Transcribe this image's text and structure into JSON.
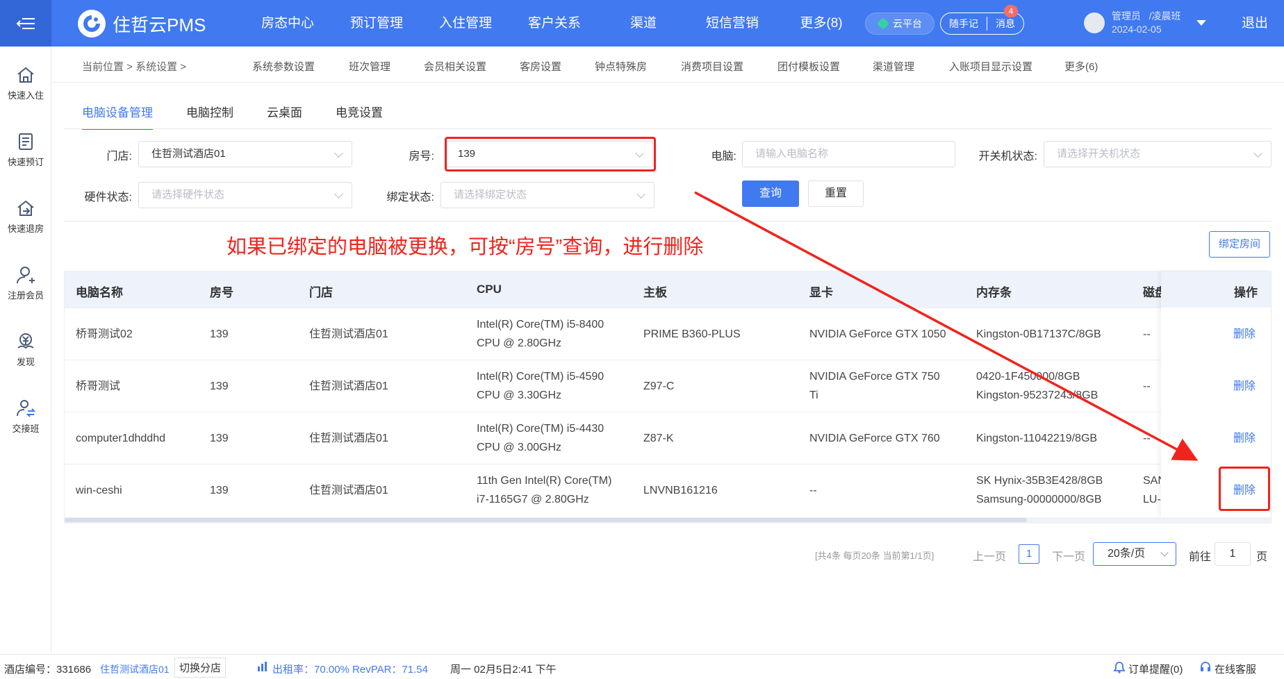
{
  "topbar": {
    "brand": "住哲云PMS",
    "nav": [
      "房态中心",
      "预订管理",
      "入住管理",
      "客户关系",
      "渠道",
      "短信营销",
      "更多(8)"
    ],
    "cloud": "云平台",
    "notes": "随手记",
    "messages": "消息",
    "msg_badge": "4",
    "user_role": "管理员",
    "user_shift": "/凌晨班",
    "user_date": "2024-02-05",
    "logout": "退出"
  },
  "sidebar": [
    {
      "label": "快速入住",
      "icon": "home-icon"
    },
    {
      "label": "快速预订",
      "icon": "document-icon"
    },
    {
      "label": "快速退房",
      "icon": "checkout-icon"
    },
    {
      "label": "注册会员",
      "icon": "add-user-icon"
    },
    {
      "label": "发现",
      "icon": "money-icon"
    },
    {
      "label": "交接班",
      "icon": "handover-icon"
    }
  ],
  "breadcrumb": {
    "text": "当前位置 > 系统设置 >"
  },
  "subnav": [
    "系统参数设置",
    "班次管理",
    "会员相关设置",
    "客房设置",
    "钟点特殊房",
    "消费项目设置",
    "团付模板设置",
    "渠道管理",
    "入账项目显示设置",
    "更多(6)"
  ],
  "tabs": [
    "电脑设备管理",
    "电脑控制",
    "云桌面",
    "电竞设置"
  ],
  "filters": {
    "store_label": "门店:",
    "store_value": "住哲测试酒店01",
    "room_label": "房号:",
    "room_value": "139",
    "pc_label": "电脑:",
    "pc_placeholder": "请输入电脑名称",
    "power_label": "开关机状态:",
    "power_placeholder": "请选择开关机状态",
    "hw_label": "硬件状态:",
    "hw_placeholder": "请选择硬件状态",
    "bind_label": "绑定状态:",
    "bind_placeholder": "请选择绑定状态",
    "query": "查询",
    "reset": "重置"
  },
  "annotation": "如果已绑定的电脑被更换，可按“房号”查询，进行删除",
  "bind_room_btn": "绑定房间",
  "table": {
    "headers": [
      "电脑名称",
      "房号",
      "门店",
      "CPU",
      "主板",
      "显卡",
      "内存条",
      "磁盘",
      "操作"
    ],
    "rows": [
      {
        "name": "桥哥测试02",
        "room": "139",
        "store": "住哲测试酒店01",
        "cpu1": "Intel(R) Core(TM) i5-8400",
        "cpu2": "CPU @ 2.80GHz",
        "board": "PRIME B360-PLUS",
        "gpu1": "NVIDIA GeForce GTX 1050",
        "gpu2": "",
        "mem1": "Kingston-0B17137C/8GB",
        "mem2": "",
        "disk1": "--",
        "disk2": "",
        "op": "删除"
      },
      {
        "name": "桥哥测试",
        "room": "139",
        "store": "住哲测试酒店01",
        "cpu1": "Intel(R) Core(TM) i5-4590",
        "cpu2": "CPU @ 3.30GHz",
        "board": "Z97-C",
        "gpu1": "NVIDIA GeForce GTX 750",
        "gpu2": "Ti",
        "mem1": "0420-1F450000/8GB",
        "mem2": "Kingston-95237243/8GB",
        "disk1": "--",
        "disk2": "",
        "op": "删除"
      },
      {
        "name": "computer1dhddhd",
        "room": "139",
        "store": "住哲测试酒店01",
        "cpu1": "Intel(R) Core(TM) i5-4430",
        "cpu2": "CPU @ 3.00GHz",
        "board": "Z87-K",
        "gpu1": "NVIDIA GeForce GTX 760",
        "gpu2": "",
        "mem1": "Kingston-11042219/8GB",
        "mem2": "",
        "disk1": "--",
        "disk2": "",
        "op": "删除"
      },
      {
        "name": "win-ceshi",
        "room": "139",
        "store": "住哲测试酒店01",
        "cpu1": "11th Gen Intel(R) Core(TM)",
        "cpu2": "i7-1165G7 @ 2.80GHz",
        "board": "LNVNB161216",
        "gpu1": "--",
        "gpu2": "",
        "mem1": "SK Hynix-35B3E428/8GB",
        "mem2": "Samsung-00000000/8GB",
        "disk1": "SAN",
        "disk2": "LU-",
        "op": "删除"
      }
    ]
  },
  "pagination": {
    "info": "[共4条 每页20条 当前第1/1页]",
    "prev": "上一页",
    "page": "1",
    "next": "下一页",
    "size": "20条/页",
    "goto": "前往",
    "goto_value": "1",
    "unit": "页"
  },
  "bottombar": {
    "hotel_no": "酒店编号：331686",
    "hotel_name": "住哲测试酒店01",
    "switch": "切换分店",
    "occupancy": "出租率：70.00% RevPAR：71.54",
    "datetime": "周一 02月5日2:41 下午",
    "order_alert": "订单提醒(0)",
    "support": "在线客服"
  },
  "colors": {
    "primary": "#4079f0",
    "annotation_red": "#f0231d"
  }
}
